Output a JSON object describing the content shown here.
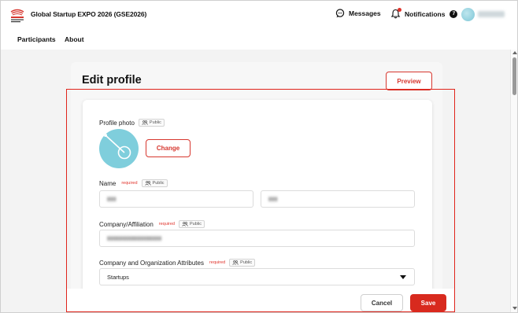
{
  "header": {
    "app_title": "Global Startup EXPO 2026 (GSE2026)",
    "messages_label": "Messages",
    "notifications_label": "Notifications",
    "notifications_count": "7"
  },
  "nav": {
    "participants": "Participants",
    "about": "About"
  },
  "page": {
    "title": "Edit profile",
    "preview_label": "Preview"
  },
  "form": {
    "profile_photo_label": "Profile photo",
    "change_label": "Change",
    "public_label": "Public",
    "required_label": "required",
    "name_label": "Name",
    "company_label": "Company/Affiliation",
    "attributes_label": "Company and Organization Attributes",
    "attributes_value": "Startups"
  },
  "footer": {
    "cancel_label": "Cancel",
    "save_label": "Save"
  },
  "colors": {
    "accent": "#d82a1e",
    "highlight": "#e0241b",
    "avatar": "#7fcedc"
  }
}
